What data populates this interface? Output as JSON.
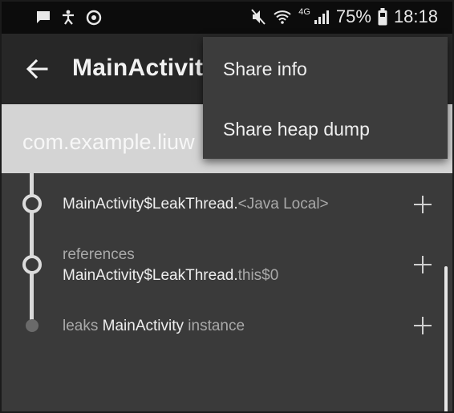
{
  "status_bar": {
    "icons_left": [
      "message-icon",
      "accessibility-icon",
      "sync-icon"
    ],
    "icons_right": [
      "mute-icon",
      "wifi-icon",
      "signal-icon",
      "battery-icon"
    ],
    "network_type": "4G",
    "battery_percent": "75%",
    "time": "18:18"
  },
  "app_bar": {
    "title": "MainActivity"
  },
  "header": {
    "package_name": "com.example.liuw"
  },
  "leak_trace": [
    {
      "secondary": "",
      "class_name": "MainActivity$LeakThread.",
      "field": "<Java Local>"
    },
    {
      "secondary": "references",
      "class_name": "MainActivity$LeakThread.",
      "field": "this$0"
    },
    {
      "prefix": "leaks ",
      "class_name": "MainActivity",
      "suffix": " instance"
    }
  ],
  "overflow_menu": {
    "items": [
      "Share info",
      "Share heap dump"
    ]
  }
}
